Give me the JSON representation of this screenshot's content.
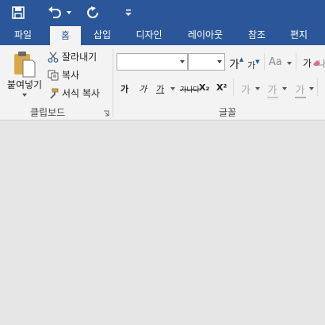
{
  "quick_access": {
    "save_icon": "save-icon",
    "undo_icon": "undo-icon",
    "redo_icon": "redo-icon",
    "customize_icon": "customize-qat-icon"
  },
  "tabs": [
    {
      "label": "파일"
    },
    {
      "label": "홈"
    },
    {
      "label": "삽입"
    },
    {
      "label": "디자인"
    },
    {
      "label": "레이아웃"
    },
    {
      "label": "참조"
    },
    {
      "label": "편지"
    }
  ],
  "clipboard": {
    "paste_label": "붙여넣기",
    "cut_label": "잘라내기",
    "copy_label": "복사",
    "format_painter_label": "서식 복사",
    "group_label": "클립보드"
  },
  "font": {
    "font_name": "",
    "font_size": "",
    "grow_label": "가",
    "shrink_label": "가",
    "case_label": "Aa",
    "clear_label": "가",
    "bold_label": "가",
    "italic_label": "가",
    "underline_label": "가",
    "strike_label": "가나다",
    "subscript_label": "X₂",
    "superscript_label": "X²",
    "effects_label": "가",
    "highlight_label": "가",
    "color_label": "가",
    "group_label": "글꼴"
  },
  "colors": {
    "brand": "#2b579a",
    "ribbon_bg": "#f3f3f3",
    "canvas_bg": "#e6e6e6"
  }
}
